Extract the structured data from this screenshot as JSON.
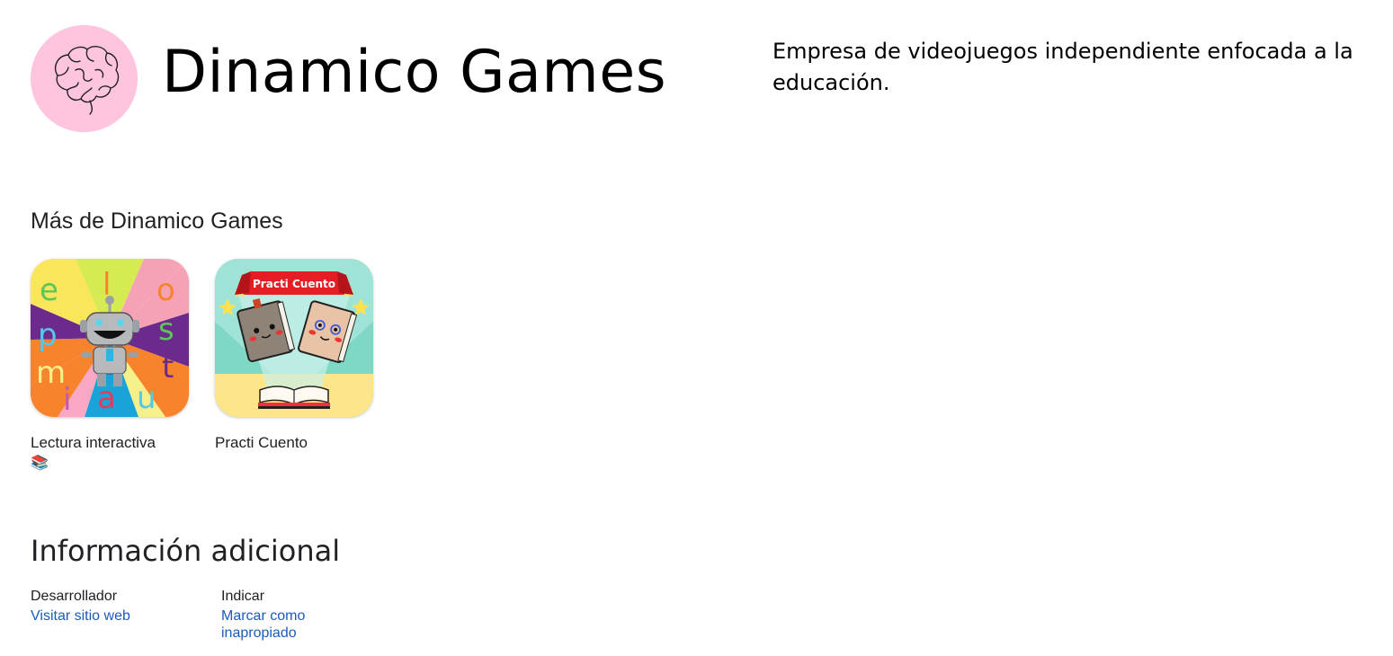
{
  "developer": {
    "name": "Dinamico Games",
    "description": "Empresa de videojuegos independiente enfocada a la educación.",
    "avatar_icon": "brain-icon",
    "avatar_bg": "#ffc4de"
  },
  "more_section": {
    "title": "Más de Dinamico Games",
    "apps": [
      {
        "name": "Lectura interactiva",
        "icon": "robot-letters-icon",
        "badge_icon": "books-badge-icon",
        "badge": "📚",
        "icon_letters": [
          "e",
          "l",
          "o",
          "p",
          "s",
          "m",
          "t",
          "i",
          "a",
          "u"
        ]
      },
      {
        "name": "Practi Cuento",
        "icon": "books-story-icon",
        "icon_banner": "Practi Cuento"
      }
    ]
  },
  "additional_info": {
    "title": "Información adicional",
    "developer_label": "Desarrollador",
    "developer_link": "Visitar sitio web",
    "report_label": "Indicar",
    "report_link": "Marcar como inapropiado"
  },
  "colors": {
    "link": "#1a5bbf",
    "text": "#202124"
  }
}
